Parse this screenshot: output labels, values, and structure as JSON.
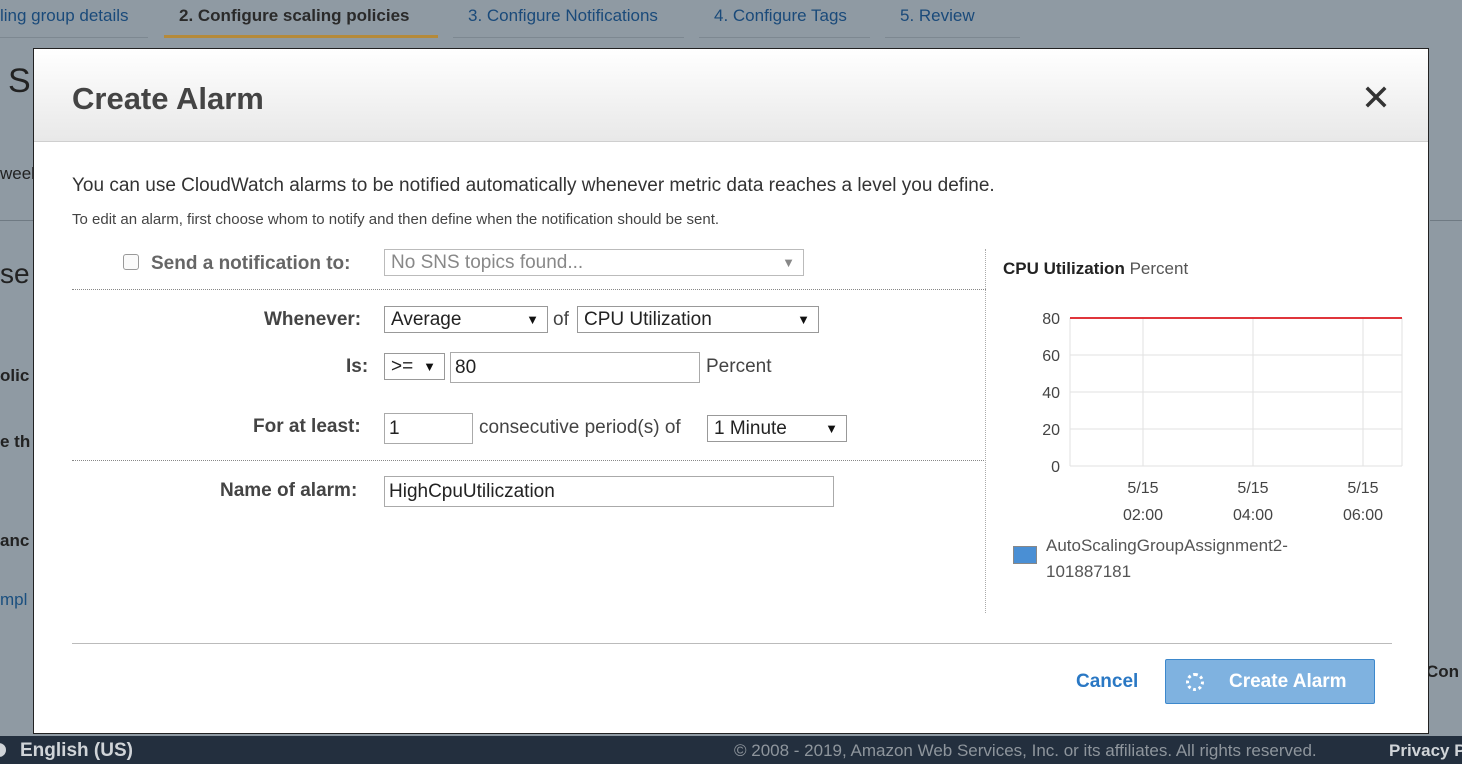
{
  "background": {
    "tabs": [
      {
        "label": "ling group details",
        "active": false
      },
      {
        "label": "2. Configure scaling policies",
        "active": true
      },
      {
        "label": "3. Configure Notifications",
        "active": false
      },
      {
        "label": "4. Configure Tags",
        "active": false
      },
      {
        "label": "5. Review",
        "active": false
      }
    ],
    "fragments": [
      "S",
      "weel",
      "se",
      "olic",
      "e th",
      "anc",
      "mpl",
      "Con"
    ]
  },
  "modal": {
    "title": "Create Alarm",
    "intro": "You can use CloudWatch alarms to be notified automatically whenever metric data reaches a level you define.",
    "subintro": "To edit an alarm, first choose whom to notify and then define when the notification should be sent.",
    "notify_label": "Send a notification to:",
    "notify_select": "No SNS topics found...",
    "whenever_label": "Whenever:",
    "statistic": "Average",
    "of_text": "of",
    "metric": "CPU Utilization",
    "is_label": "Is:",
    "operator": ">=",
    "threshold": "80",
    "threshold_unit": "Percent",
    "for_label": "For at least:",
    "periods": "1",
    "periods_text": "consecutive period(s) of",
    "period_length": "1 Minute",
    "name_label": "Name of alarm:",
    "alarm_name": "HighCpuUtiliczation",
    "cancel": "Cancel",
    "create": "Create Alarm"
  },
  "chart_data": {
    "type": "line",
    "title": "CPU Utilization",
    "unit": "Percent",
    "ylim": [
      0,
      80
    ],
    "yticks": [
      "80",
      "60",
      "40",
      "20",
      "0"
    ],
    "xticks": [
      {
        "date": "5/15",
        "time": "02:00"
      },
      {
        "date": "5/15",
        "time": "04:00"
      },
      {
        "date": "5/15",
        "time": "06:00"
      }
    ],
    "threshold": 80,
    "threshold_color": "#e0353b",
    "legend": [
      "AutoScalingGroupAssignment2-",
      "101887181"
    ],
    "series_color": "#4a8fd4",
    "grid": true
  },
  "footer": {
    "language": "English (US)",
    "copyright": "© 2008 - 2019, Amazon Web Services, Inc. or its affiliates. All rights reserved.",
    "privacy": "Privacy P"
  }
}
